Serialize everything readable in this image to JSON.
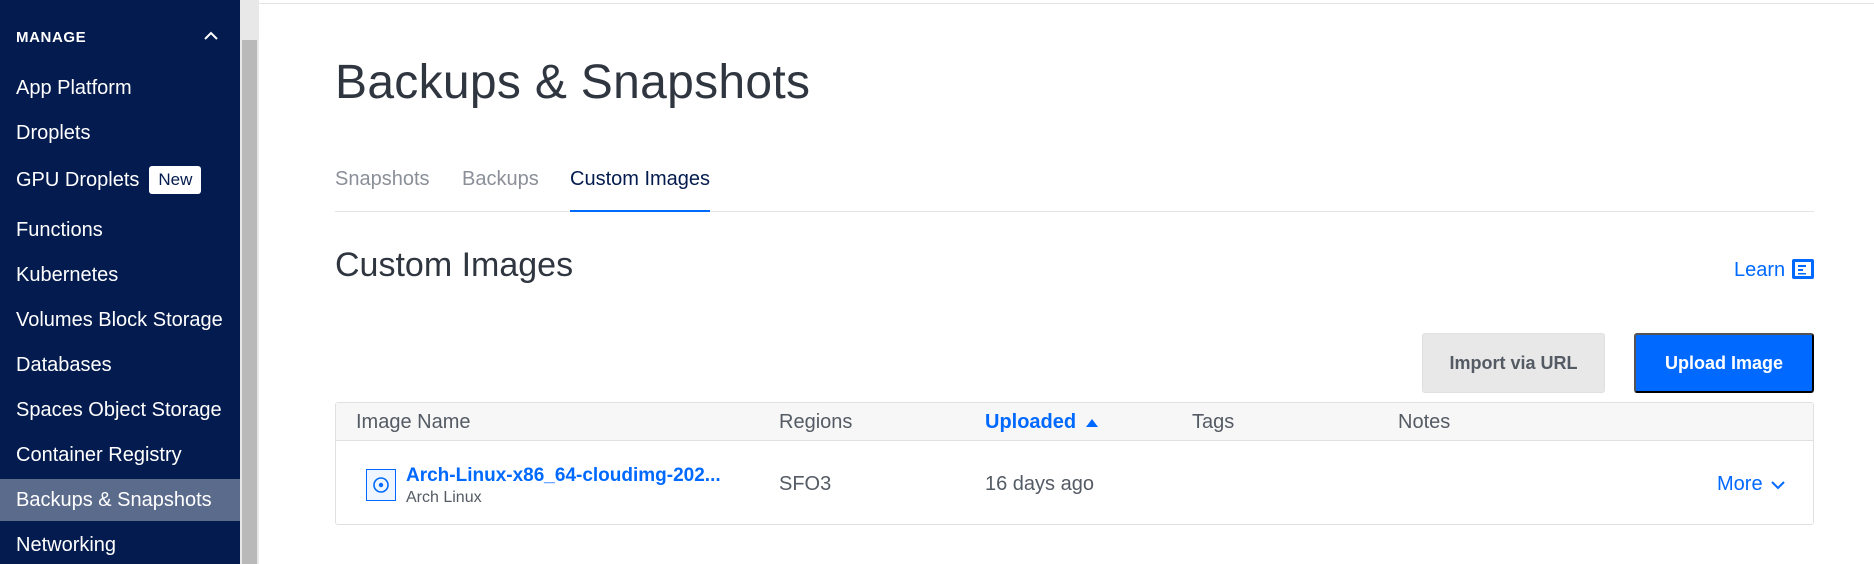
{
  "sidebar": {
    "section_title": "MANAGE",
    "items": [
      {
        "label": "App Platform"
      },
      {
        "label": "Droplets"
      },
      {
        "label": "GPU Droplets",
        "badge": "New"
      },
      {
        "label": "Functions"
      },
      {
        "label": "Kubernetes"
      },
      {
        "label": "Volumes Block Storage"
      },
      {
        "label": "Databases"
      },
      {
        "label": "Spaces Object Storage"
      },
      {
        "label": "Container Registry"
      },
      {
        "label": "Backups & Snapshots",
        "active": true
      },
      {
        "label": "Networking"
      }
    ]
  },
  "main": {
    "page_title": "Backups & Snapshots",
    "tabs": [
      {
        "label": "Snapshots"
      },
      {
        "label": "Backups"
      },
      {
        "label": "Custom Images",
        "active": true
      }
    ],
    "section_title": "Custom Images",
    "learn_label": "Learn",
    "import_button": "Import via URL",
    "upload_button": "Upload Image",
    "table": {
      "columns": [
        "Image Name",
        "Regions",
        "Uploaded",
        "Tags",
        "Notes"
      ],
      "sorted_column": "Uploaded",
      "rows": [
        {
          "name": "Arch-Linux-x86_64-cloudimg-202...",
          "distribution": "Arch Linux",
          "region": "SFO3",
          "uploaded": "16 days ago",
          "tags": "",
          "notes": "",
          "action": "More"
        }
      ]
    }
  },
  "colors": {
    "sidebar_bg": "#031b4e",
    "accent": "#0069ff",
    "active_item_bg": "#5b6b8c"
  },
  "icons": {
    "collapse": "chevron-up-icon",
    "docs": "docs-icon",
    "sort": "sort-asc-icon",
    "image": "disk-image-icon",
    "more": "chevron-down-icon"
  }
}
